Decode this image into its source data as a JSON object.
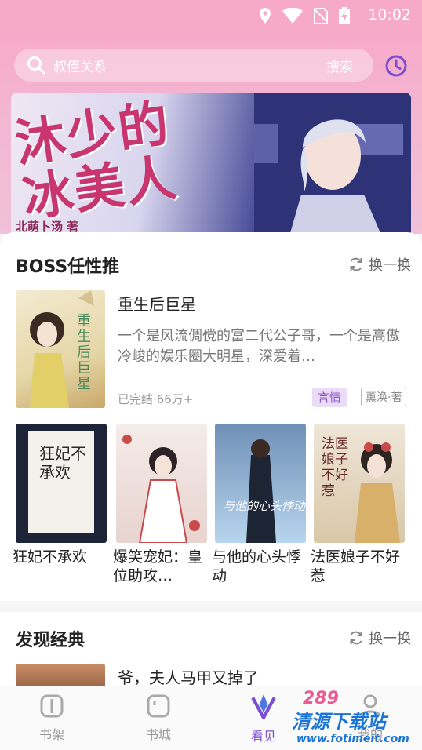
{
  "status_bar": {
    "time": "10:02",
    "icons": [
      "location-icon",
      "wifi-icon",
      "no-sim-icon",
      "battery-charging-icon"
    ]
  },
  "search": {
    "placeholder": "叔侄关系",
    "button": "搜索",
    "history_icon": "clock-icon"
  },
  "banner": {
    "title_line1": "沐少的",
    "title_line2": "冰美人",
    "author": "北萌卜汤 著"
  },
  "boss_section": {
    "title": "BOSS任性推",
    "refresh": "换一换",
    "featured": {
      "title": "重生后巨星",
      "description": "一个是风流倜傥的富二代公子哥，一个是高傲冷峻的娱乐圈大明星，深爱着…",
      "meta": "已完结·66万+",
      "genre": "言情",
      "author": "薰涣·著",
      "cover_text": "重生后巨星"
    },
    "books": [
      {
        "title": "狂妃不承欢",
        "cover_text": "狂妃不承欢"
      },
      {
        "title": "爆笑宠妃：皇位助攻…",
        "cover_text": ""
      },
      {
        "title": "与他的心头悸动",
        "cover_text": "与他的心头悸动"
      },
      {
        "title": "法医娘子不好惹",
        "cover_text": "法医娘子不好惹"
      }
    ]
  },
  "classic_section": {
    "title": "发现经典",
    "refresh": "换一换",
    "first_book": "爷，夫人马甲又掉了"
  },
  "tabs": [
    {
      "label": "书架",
      "icon": "bookshelf-icon"
    },
    {
      "label": "书城",
      "icon": "bookstore-icon"
    },
    {
      "label": "看见",
      "icon": "discover-icon"
    },
    {
      "label": "我的",
      "icon": "profile-icon"
    }
  ],
  "watermark": {
    "brand": "清源下载站",
    "url": "www.fotimeit.com",
    "number": "289"
  },
  "colors": {
    "accent": "#7b4fd0",
    "header_pink": "#f7a9c8",
    "genre_tag_bg": "#eadcf7"
  }
}
